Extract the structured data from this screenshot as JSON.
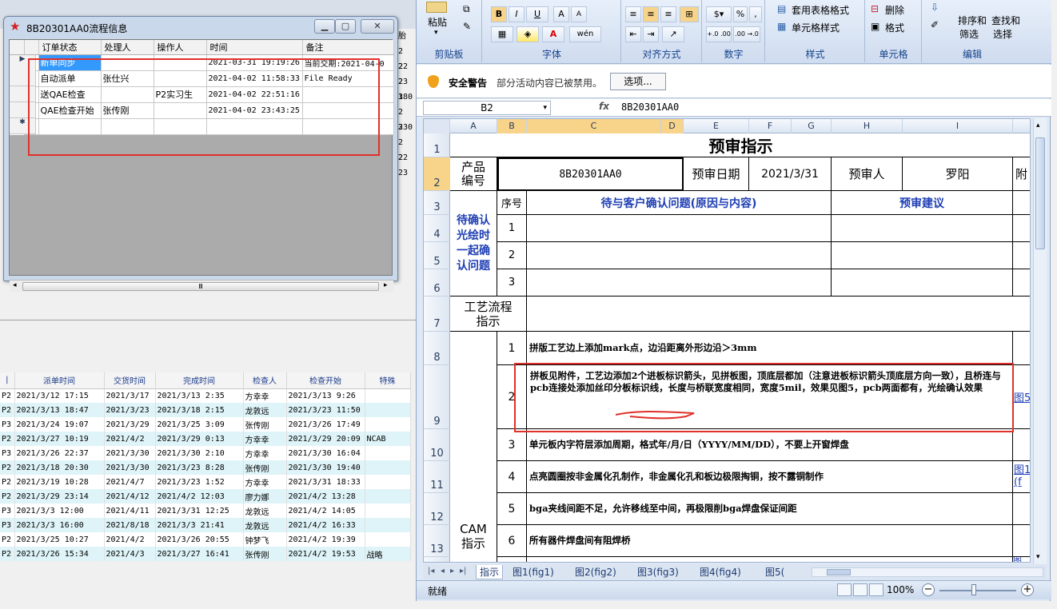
{
  "flow_window": {
    "title": "8B20301AA0流程信息",
    "columns": [
      "订单状态",
      "处理人",
      "操作人",
      "时间",
      "备注"
    ],
    "rows": [
      {
        "status": "新单同步",
        "handler": "",
        "operator": "",
        "time": "2021-03-31 19:19:26",
        "note": "当前交期:2021-04-0"
      },
      {
        "status": "自动派单",
        "handler": "张仕兴",
        "operator": "",
        "time": "2021-04-02 11:58:33",
        "note": "File Ready"
      },
      {
        "status": "送QAE检查",
        "handler": "",
        "operator": "P2实习生",
        "time": "2021-04-02 22:51:16",
        "note": ""
      },
      {
        "status": "QAE检查开始",
        "handler": "张传刚",
        "operator": "",
        "time": "2021-04-02 23:43:25",
        "note": ""
      }
    ],
    "current_row_marker": "▶",
    "new_row_marker": "✱",
    "scroll_thumb": "Ⅲ"
  },
  "bg_app": {
    "right_edge_text": [
      "胎",
      "2 22",
      "2 23",
      "2 18",
      "3 0",
      "2 23",
      "3 0",
      "2 22",
      "2 23"
    ],
    "columns": [
      "|",
      "派单时间",
      "交货时间",
      "完成时间",
      "检查人",
      "检查开始",
      "特殊"
    ],
    "rows": [
      [
        "P2",
        "2021/3/12 17:15",
        "2021/3/17",
        "2021/3/13 2:35",
        "方幸幸",
        "2021/3/13 9:26",
        ""
      ],
      [
        "P2",
        "2021/3/13 18:47",
        "2021/3/23",
        "2021/3/18 2:15",
        "龙敦远",
        "2021/3/23 11:50",
        ""
      ],
      [
        "P3",
        "2021/3/24 19:07",
        "2021/3/29",
        "2021/3/25 3:09",
        "张传刚",
        "2021/3/26 17:49",
        ""
      ],
      [
        "P2",
        "2021/3/27 10:19",
        "2021/4/2",
        "2021/3/29 0:13",
        "方幸幸",
        "2021/3/29 20:09",
        "NCAB"
      ],
      [
        "P3",
        "2021/3/26 22:37",
        "2021/3/30",
        "2021/3/30 2:10",
        "方幸幸",
        "2021/3/30 16:04",
        ""
      ],
      [
        "P2",
        "2021/3/18 20:30",
        "2021/3/30",
        "2021/3/23 8:28",
        "张传刚",
        "2021/3/30 19:40",
        ""
      ],
      [
        "P2",
        "2021/3/19 10:28",
        "2021/4/7",
        "2021/3/23 1:52",
        "方幸幸",
        "2021/3/31 18:33",
        ""
      ],
      [
        "P2",
        "2021/3/29 23:14",
        "2021/4/12",
        "2021/4/2 12:03",
        "廖力娜",
        "2021/4/2 13:28",
        ""
      ],
      [
        "P3",
        "2021/3/3 12:00",
        "2021/4/11",
        "2021/3/31 12:25",
        "龙敦远",
        "2021/4/2 14:05",
        ""
      ],
      [
        "P3",
        "2021/3/3 16:00",
        "2021/8/18",
        "2021/3/3 21:41",
        "龙敦远",
        "2021/4/2 16:33",
        ""
      ],
      [
        "P2",
        "2021/3/25 10:27",
        "2021/4/2",
        "2021/3/26 20:55",
        "钟梦飞",
        "2021/4/2 19:39",
        ""
      ],
      [
        "P2",
        "2021/3/26 15:34",
        "2021/4/3",
        "2021/3/27 16:41",
        "张传刚",
        "2021/4/2 19:53",
        "战略"
      ]
    ]
  },
  "excel": {
    "ribbon": {
      "paste": "粘贴",
      "clipboard": "剪贴板",
      "font": "字体",
      "alignment": "对齐方式",
      "number": "数字",
      "styles": "样式",
      "cells": "单元格",
      "editing": "编辑",
      "bold": "B",
      "italic": "I",
      "underline": "U",
      "font_grow": "A",
      "font_shrink": "A",
      "wen": "wén",
      "percent": "%",
      "comma": ",",
      "dec_inc": "+.0 .00",
      "dec_dec": ".00 →.0",
      "table_format": "套用表格格式",
      "cell_styles": "单元格样式",
      "delete": "删除",
      "format": "格式",
      "sort_filter_1": "排序和",
      "sort_filter_2": "筛选",
      "find_select_1": "查找和",
      "find_select_2": "选择"
    },
    "security": {
      "warning": "安全警告",
      "message": "部分活动内容已被禁用。",
      "options_button": "选项..."
    },
    "name_box": "B2",
    "fx": "fx",
    "formula": "8B20301AA0",
    "col_headers": [
      "A",
      "B",
      "C",
      "D",
      "E",
      "F",
      "G",
      "H",
      "I"
    ],
    "row_headers": [
      "1",
      "2",
      "3",
      "4",
      "5",
      "6",
      "7",
      "8",
      "9",
      "10",
      "11",
      "12",
      "13"
    ],
    "sheet": {
      "title": "预审指示",
      "product_no_label": "产品\n编号",
      "product_no": "8B20301AA0",
      "review_date_label": "预审日期",
      "review_date": "2021/3/31",
      "reviewer_label": "预审人",
      "reviewer": "罗阳",
      "attach_label": "附",
      "seq_label": "序号",
      "issues_header": "待与客户确认问题(原因与内容)",
      "suggest_header": "预审建议",
      "confirm_label": "待确认光绘时一起确认问题",
      "seq_1": "1",
      "seq_2": "2",
      "seq_3": "3",
      "process_label": "工艺流程指示",
      "cam_label": "CAM\n指示",
      "instructions": [
        {
          "no": "1",
          "text": "拼版工艺边上添加mark点，边沿距离外形边沿＞3mm",
          "link": ""
        },
        {
          "no": "2",
          "text": "拼板见附件，工艺边添加2个进板标识箭头，见拼板图，顶底层都加（注意进板标识箭头顶底层方向一致），且桥连与pcb连接处添加丝印分板标识线，长度与桥联宽度相同，宽度5mil，效果见图5，pcb两面都有，光绘确认效果",
          "link": "图5"
        },
        {
          "no": "3",
          "text": "单元板内字符层添加周期，格式年/月/日（YYYY/MM/DD），不要上开窗焊盘",
          "link": ""
        },
        {
          "no": "4",
          "text": "点亮圆圈按非金属化孔制作，非金属化孔和板边极限掏铜，按不露铜制作",
          "link": "图1(f"
        },
        {
          "no": "5",
          "text": "bga夹线间距不足，允许移线至中间，再极限削bga焊盘保证间距",
          "link": ""
        },
        {
          "no": "6",
          "text": "所有器件焊盘间有阻焊桥",
          "link": ""
        }
      ],
      "last_link": "图"
    },
    "tabs": [
      "指示",
      "图1(fig1)",
      "图2(fig2)",
      "图3(fig3)",
      "图4(fig4)",
      "图5("
    ],
    "status": "就绪",
    "zoom": "100%"
  }
}
